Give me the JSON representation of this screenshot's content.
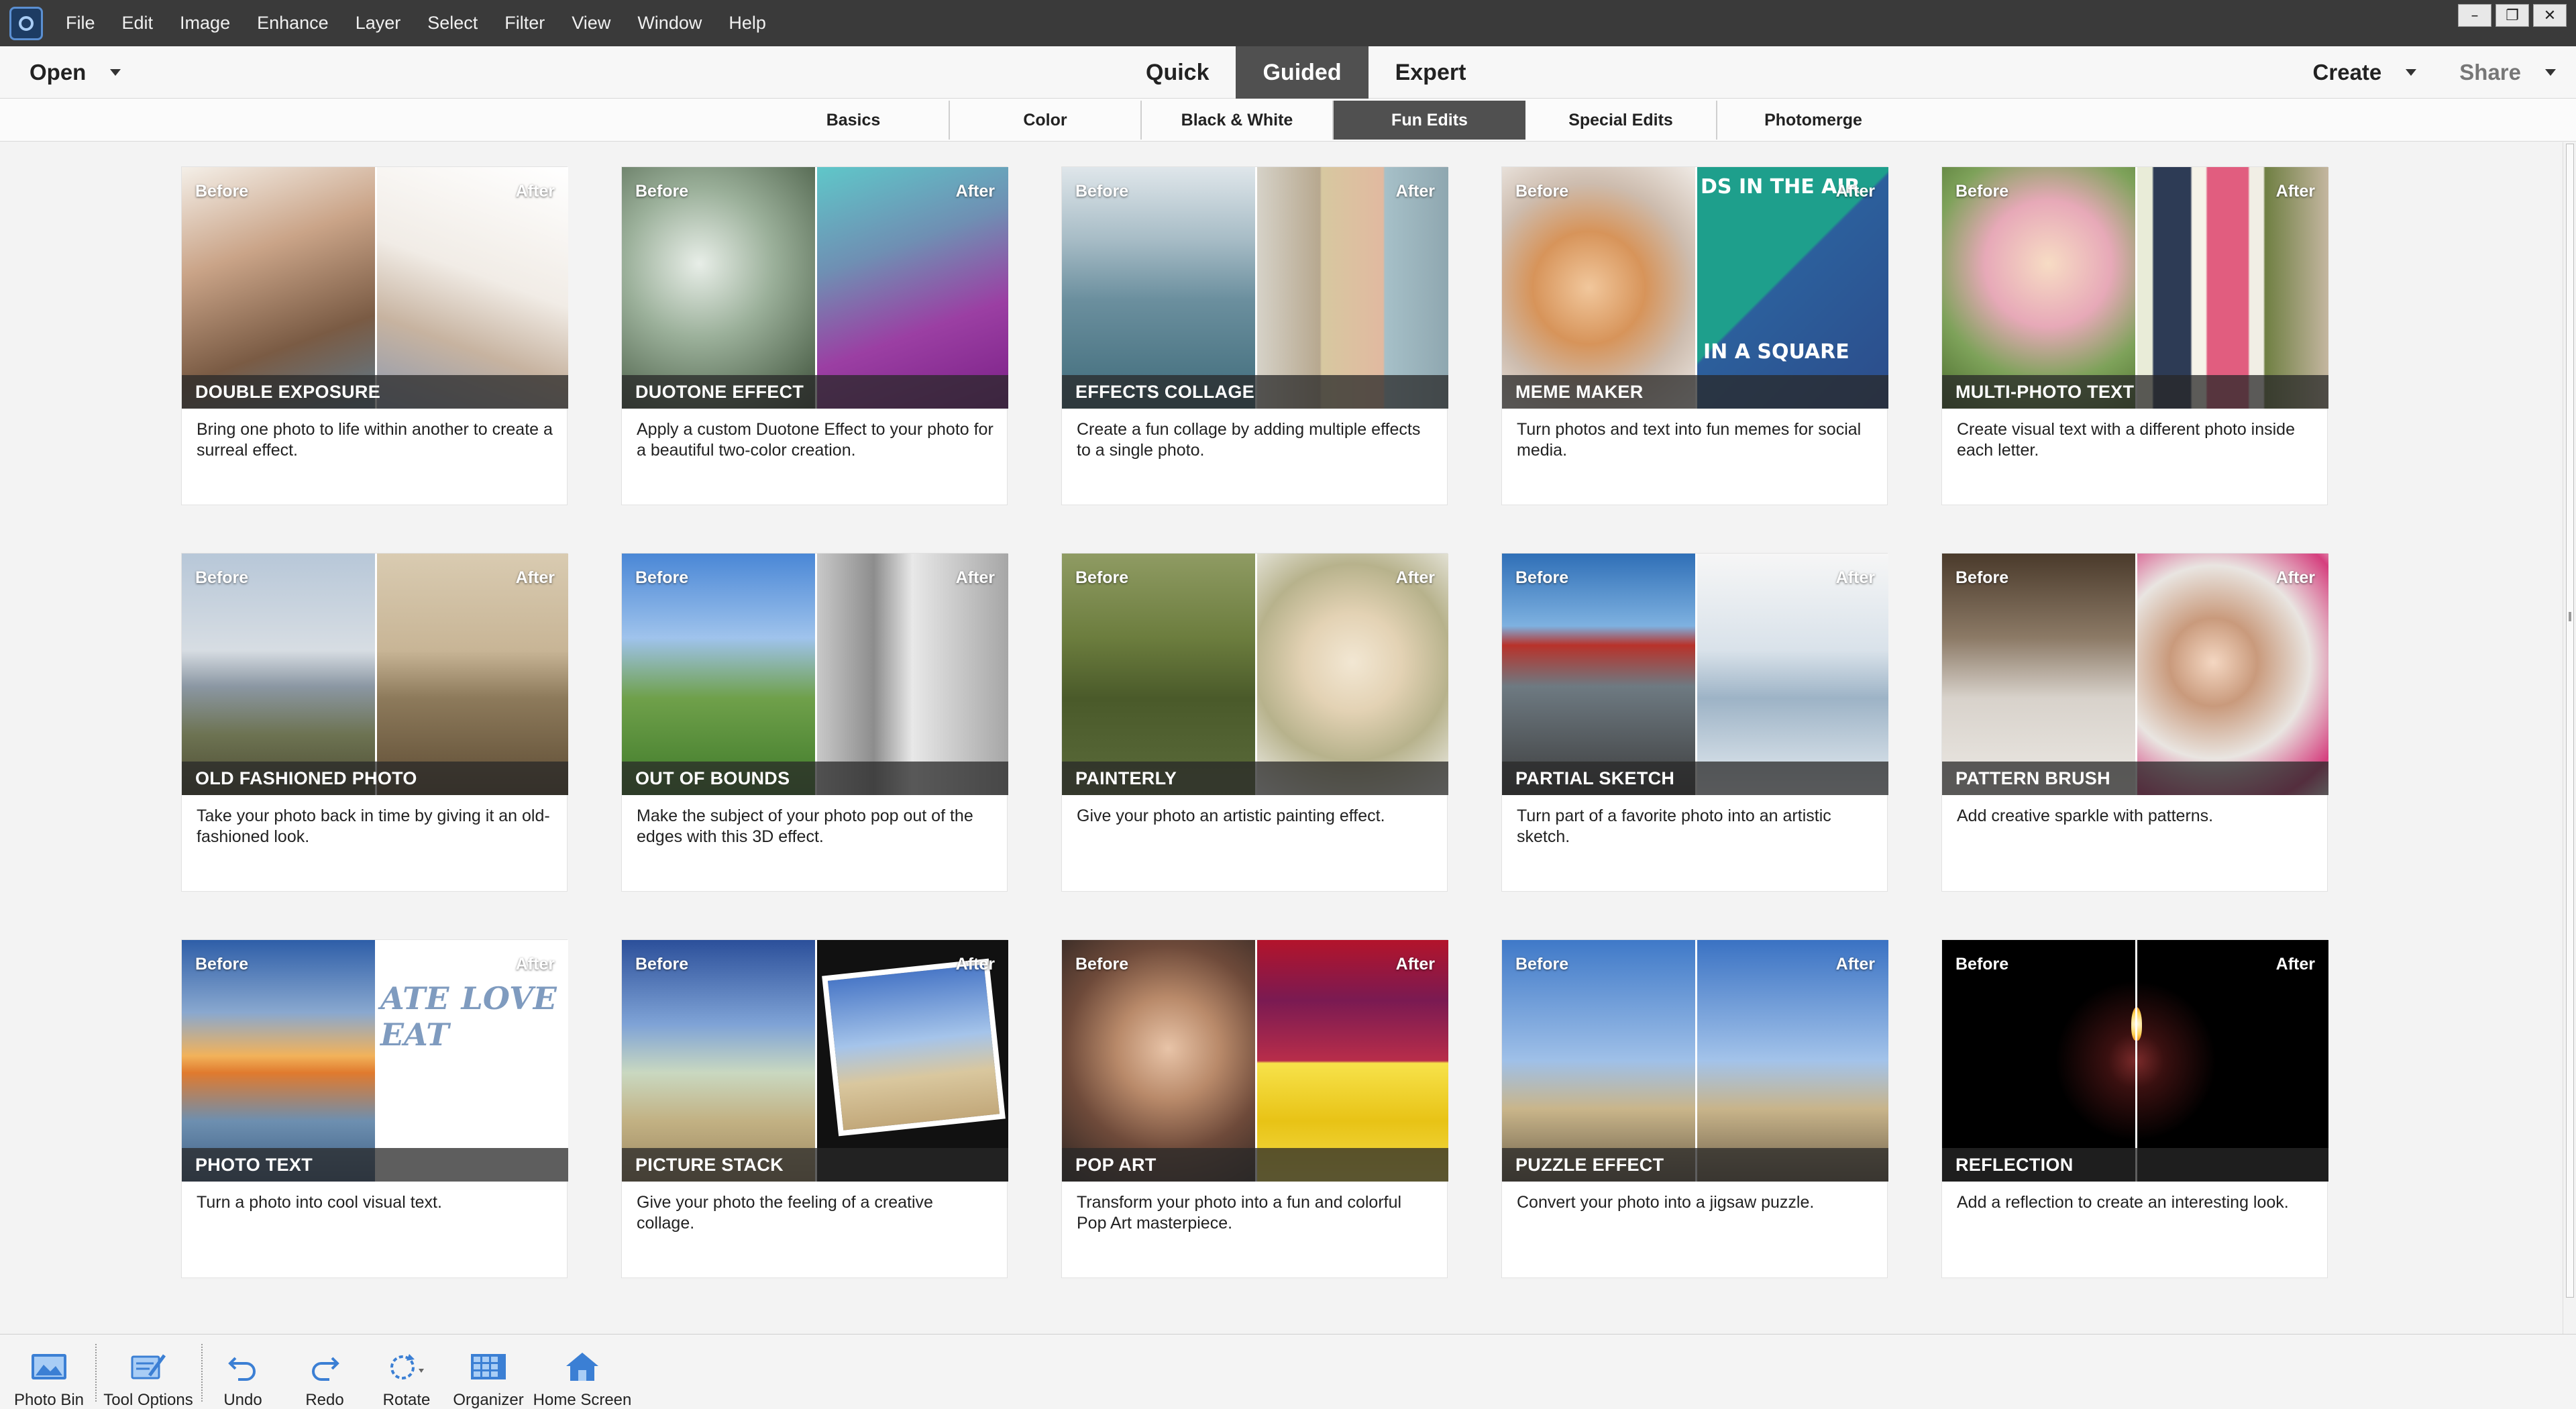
{
  "menubar": {
    "items": [
      "File",
      "Edit",
      "Image",
      "Enhance",
      "Layer",
      "Select",
      "Filter",
      "View",
      "Window",
      "Help"
    ]
  },
  "modebar": {
    "open_label": "Open",
    "modes": [
      "Quick",
      "Guided",
      "Expert"
    ],
    "active_mode": "Guided",
    "create_label": "Create",
    "share_label": "Share"
  },
  "categories": {
    "tabs": [
      "Basics",
      "Color",
      "Black & White",
      "Fun Edits",
      "Special Edits",
      "Photomerge"
    ],
    "active": "Fun Edits"
  },
  "labels": {
    "before": "Before",
    "after": "After"
  },
  "cards": [
    {
      "title": "DOUBLE EXPOSURE",
      "desc": "Bring one photo to life within another to create a surreal effect."
    },
    {
      "title": "DUOTONE EFFECT",
      "desc": "Apply a custom Duotone Effect to your photo for a beautiful two-color creation."
    },
    {
      "title": "EFFECTS COLLAGE",
      "desc": "Create a fun collage by adding multiple effects to a single photo."
    },
    {
      "title": "MEME MAKER",
      "desc": "Turn photos and text into fun memes for social media.",
      "overlay_top": "DS IN THE AIR",
      "overlay_bottom": "IN A SQUARE"
    },
    {
      "title": "MULTI-PHOTO TEXT",
      "desc": "Create visual text with a different photo inside each letter."
    },
    {
      "title": "OLD FASHIONED PHOTO",
      "desc": "Take your photo back in time by giving it an old-fashioned look."
    },
    {
      "title": "OUT OF BOUNDS",
      "desc": "Make the subject of your photo pop out of the edges with this 3D effect."
    },
    {
      "title": "PAINTERLY",
      "desc": "Give your photo an artistic painting effect."
    },
    {
      "title": "PARTIAL SKETCH",
      "desc": "Turn part of a favorite photo into an artistic sketch."
    },
    {
      "title": "PATTERN BRUSH",
      "desc": "Add creative sparkle with patterns."
    },
    {
      "title": "PHOTO TEXT",
      "desc": "Turn a photo into cool visual text.",
      "overlay_text": "ATE LOVE EAT"
    },
    {
      "title": "PICTURE STACK",
      "desc": "Give your photo the feeling of a creative collage."
    },
    {
      "title": "POP ART",
      "desc": "Transform your photo into a fun and colorful Pop Art masterpiece."
    },
    {
      "title": "PUZZLE EFFECT",
      "desc": "Convert your photo into a jigsaw puzzle."
    },
    {
      "title": "REFLECTION",
      "desc": "Add a reflection to create an interesting look."
    }
  ],
  "bottombar": {
    "photo_bin": "Photo Bin",
    "tool_options": "Tool Options",
    "undo": "Undo",
    "redo": "Redo",
    "rotate": "Rotate",
    "organizer": "Organizer",
    "home_screen": "Home Screen"
  },
  "colors": {
    "menubar_bg": "#3a3a3a",
    "active_tab_bg": "#505050",
    "accent_blue": "#3b7fd4"
  }
}
